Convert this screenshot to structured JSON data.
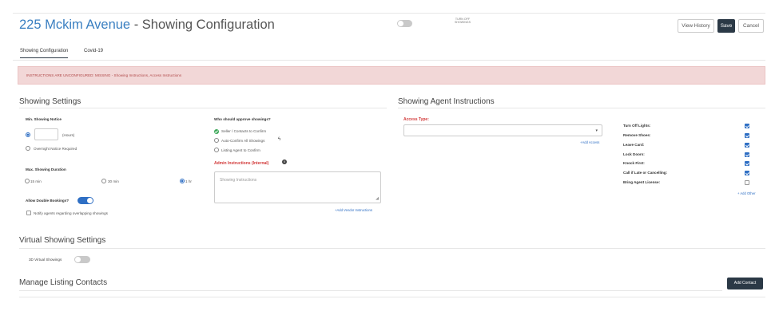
{
  "header": {
    "address": "225 Mckim Avenue",
    "title_suffix": " - Showing Configuration",
    "turn_off_label": "TURN OFF SHOWINGS",
    "buttons": {
      "history": "View History",
      "save": "Save",
      "cancel": "Cancel"
    }
  },
  "tabs": [
    {
      "label": "Showing Configuration",
      "active": true
    },
    {
      "label": "Covid-19",
      "active": false
    }
  ],
  "alert": {
    "text": "INSTRUCTIONS ARE UNCONFIGURED: MISSING - Showing Instructions, Access Instructions"
  },
  "showing_settings": {
    "title": "Showing Settings",
    "min_notice_label": "Min. Showing Notice",
    "hours_value": "",
    "hours_label": "(Hours)",
    "overnight_label": "Overnight Notice Required",
    "max_duration_label": "Max. Showing Duration",
    "durations": [
      {
        "label": "15 min",
        "checked": false
      },
      {
        "label": "30 min",
        "checked": false
      },
      {
        "label": "1 hr",
        "checked": true
      }
    ],
    "double_bookings_label": "Allow Double Bookings?",
    "notify_label": "Notify agents regarding overlapping showings",
    "approve_label": "Who should approve showings?",
    "approve_options": [
      {
        "label": "Seller / Contacts to Confirm",
        "checked": true
      },
      {
        "label": "Auto-Confirm All Showings",
        "checked": false
      },
      {
        "label": "Listing Agent to Confirm",
        "checked": false
      }
    ],
    "auto_confirm_icon": "lightning-icon",
    "admin_label": "Admin Instructions (Internal)",
    "admin_placeholder": "Showing Instructions",
    "add_vendor_link": "+Add Vendor Instructions"
  },
  "agent_instructions": {
    "title": "Showing Agent Instructions",
    "access_type_label": "Access Type:",
    "add_access_link": "+Add Access",
    "items": [
      {
        "label": "Turn Off Lights:",
        "checked": true
      },
      {
        "label": "Remove Shoes:",
        "checked": true
      },
      {
        "label": "Leave Card:",
        "checked": true
      },
      {
        "label": "Lock Doors:",
        "checked": true
      },
      {
        "label": "Knock First:",
        "checked": true
      },
      {
        "label": "Call if Late or Cancelling:",
        "checked": true
      },
      {
        "label": "Bring Agent License:",
        "checked": false
      }
    ],
    "add_other_link": "+ Add Other"
  },
  "virtual": {
    "title": "Virtual Showing Settings",
    "toggle_label": "3D Virtual Showings"
  },
  "contacts": {
    "title": "Manage Listing Contacts",
    "add_button": "Add Contact"
  }
}
